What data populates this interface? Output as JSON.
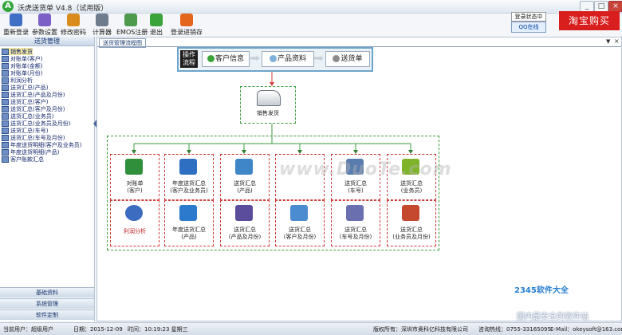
{
  "window": {
    "title": "沃虎送货单 V4.8（试用版）",
    "logo": "A"
  },
  "toolbar": [
    {
      "label": "重新登录",
      "icon": "relogin-icon",
      "color": "#3f6fc4"
    },
    {
      "label": "参数设置",
      "icon": "settings-icon",
      "color": "#7b5fc6"
    },
    {
      "label": "修改密码",
      "icon": "password-icon",
      "color": "#d98c1c"
    },
    {
      "label": "计算器",
      "icon": "calculator-icon",
      "color": "#6f7c8c"
    },
    {
      "label": "EMOS注册",
      "icon": "register-icon",
      "color": "#4d9a4d"
    },
    {
      "label": "退出",
      "icon": "exit-icon",
      "color": "#3aa43a"
    },
    {
      "label": "登录进销存",
      "icon": "inventory-login-icon",
      "color": "#e3661c"
    }
  ],
  "top_right": {
    "login_status": "登录状态中",
    "qq": "QQ在线",
    "taobao": "淘宝购买"
  },
  "left_panel": {
    "title": "送货管理",
    "items": [
      "销售发货",
      "对账单(客户)",
      "对账单(金额)",
      "对账单(月份)",
      "利润分析",
      "送货汇总(产品)",
      "送货汇总(产品及月份)",
      "送货汇总(客户)",
      "送货汇总(客户及月份)",
      "送货汇总(业务员)",
      "送货汇总(业务员及月份)",
      "送货汇总(车号)",
      "送货汇总(车号及月份)",
      "年度送货明细(客户及业务员)",
      "年度送货明细(产品)",
      "客户账款汇总"
    ],
    "bottom_tabs": [
      "基础资料",
      "系统管理",
      "软件定制"
    ]
  },
  "right_panel": {
    "tab": "送货管理流程图",
    "flow": {
      "label": "操作流程",
      "steps": [
        "客户信息",
        "产品资料",
        "送货单"
      ]
    },
    "van_label": "销售发货",
    "cells_row1": [
      {
        "l1": "对账单",
        "l2": "(客户)",
        "color": "#2f8f3a",
        "icon": "statement-icon"
      },
      {
        "l1": "年度送货汇总",
        "l2": "(客户及业务员)",
        "color": "#2e6fc2",
        "icon": "annual-summary-icon"
      },
      {
        "l1": "送货汇总",
        "l2": "(产品)",
        "color": "#3f86c9",
        "icon": "product-summary-icon"
      },
      {
        "l1": "",
        "l2": "",
        "color": "",
        "icon": ""
      },
      {
        "l1": "送货汇总",
        "l2": "(车号)",
        "color": "#5a7db0",
        "icon": "vehicle-summary-icon"
      },
      {
        "l1": "送货汇总",
        "l2": "(业务员)",
        "color": "#7fb42a",
        "icon": "salesman-summary-icon"
      }
    ],
    "cells_row2": [
      {
        "l1": "利润分析",
        "l2": "",
        "color": "#3c6cc0",
        "icon": "profit-analysis-icon",
        "red": true
      },
      {
        "l1": "年度送货汇总",
        "l2": "(产品)",
        "color": "#2b7acb",
        "icon": "annual-product-icon"
      },
      {
        "l1": "送货汇总",
        "l2": "(产品及月份)",
        "color": "#5b4c9c",
        "icon": "product-month-icon"
      },
      {
        "l1": "送货汇总",
        "l2": "(客户及月份)",
        "color": "#4b8bd0",
        "icon": "customer-month-icon"
      },
      {
        "l1": "送货汇总",
        "l2": "(车号及月份)",
        "color": "#6a6fb0",
        "icon": "vehicle-month-icon"
      },
      {
        "l1": "送货汇总",
        "l2": "(业务员及月份)",
        "color": "#c4492f",
        "icon": "salesman-month-icon"
      }
    ]
  },
  "watermark": "www.DuoTe.com",
  "statusbar": {
    "user": "当前用户：超级用户",
    "date": "日期：2015-12-09",
    "time": "时间：10:19:23 星期三",
    "copyright": "版权所有：深圳市奥科亿科技有限公司",
    "hotline": "咨询热线：0755-33165095",
    "email": "E-Mail：okeysoft@163.com"
  },
  "corner": {
    "brand": "2345软件大全",
    "slogan": "国内最安全的软件站"
  }
}
